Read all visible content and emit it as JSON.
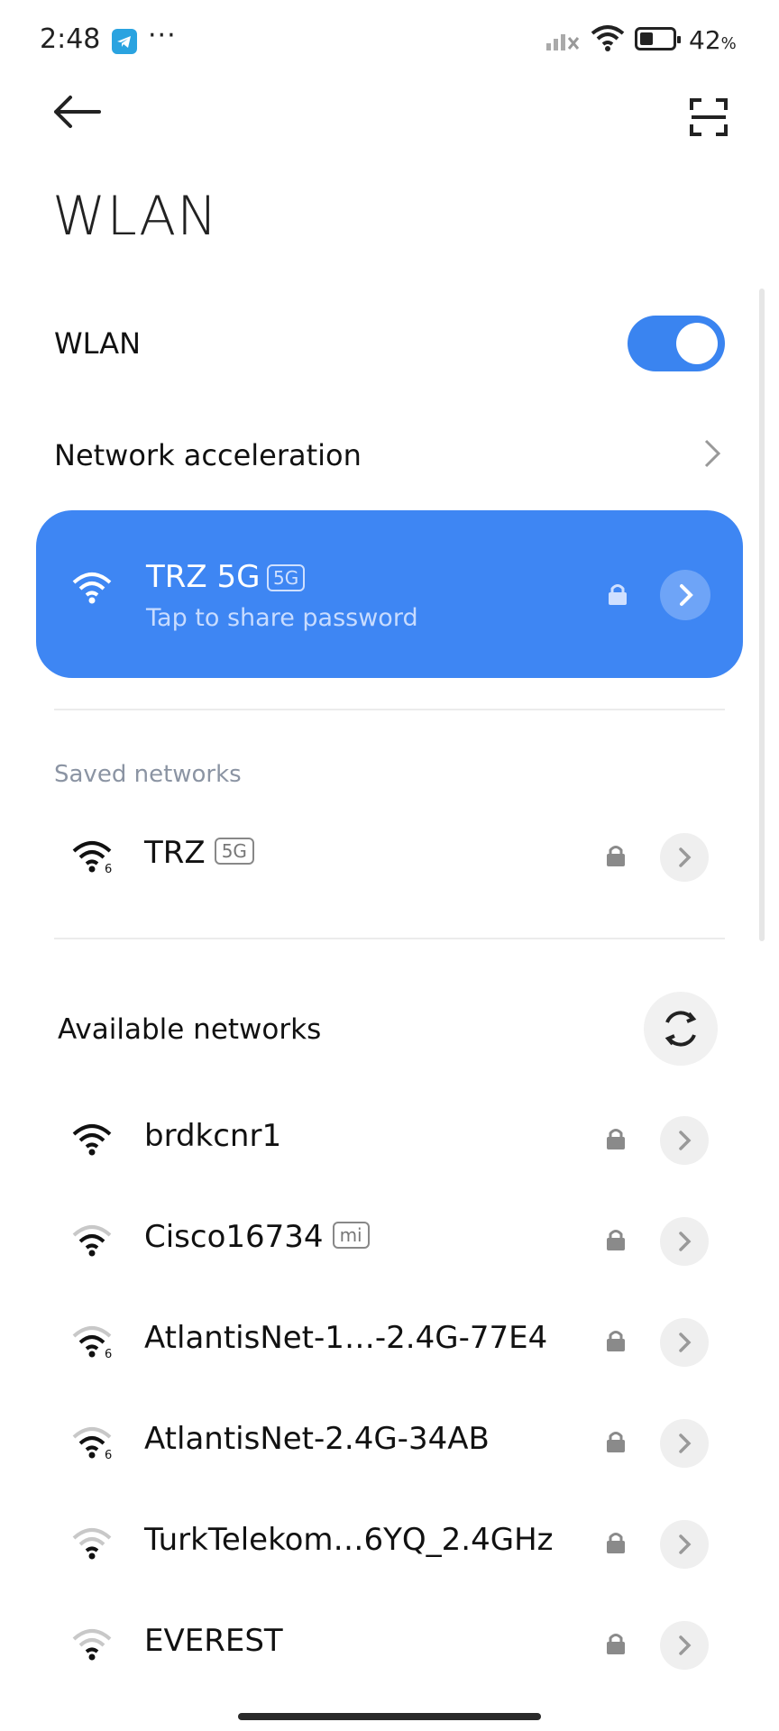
{
  "status_bar": {
    "time": "2:48",
    "battery_percent": "42",
    "battery_unit": "%"
  },
  "header": {
    "title": "WLAN"
  },
  "wlan_toggle": {
    "label": "WLAN",
    "enabled": true
  },
  "network_acceleration": {
    "label": "Network acceleration"
  },
  "connected": {
    "name": "TRZ 5G",
    "band": "5G",
    "subtitle": "Tap to share password"
  },
  "saved": {
    "header": "Saved networks",
    "items": [
      {
        "name": "TRZ",
        "badge": "5G"
      }
    ]
  },
  "available": {
    "header": "Available networks",
    "items": [
      {
        "name": "brdkcnr1",
        "badge": ""
      },
      {
        "name": "Cisco16734",
        "badge": "mi"
      },
      {
        "name": "AtlantisNet-1…-2.4G-77E4",
        "badge": ""
      },
      {
        "name": "AtlantisNet-2.4G-34AB",
        "badge": ""
      },
      {
        "name": "TurkTelekom…6YQ_2.4GHz",
        "badge": ""
      },
      {
        "name": "EVEREST",
        "badge": ""
      }
    ]
  },
  "colors": {
    "accent": "#3e86f3",
    "toggle": "#3a84f0"
  }
}
